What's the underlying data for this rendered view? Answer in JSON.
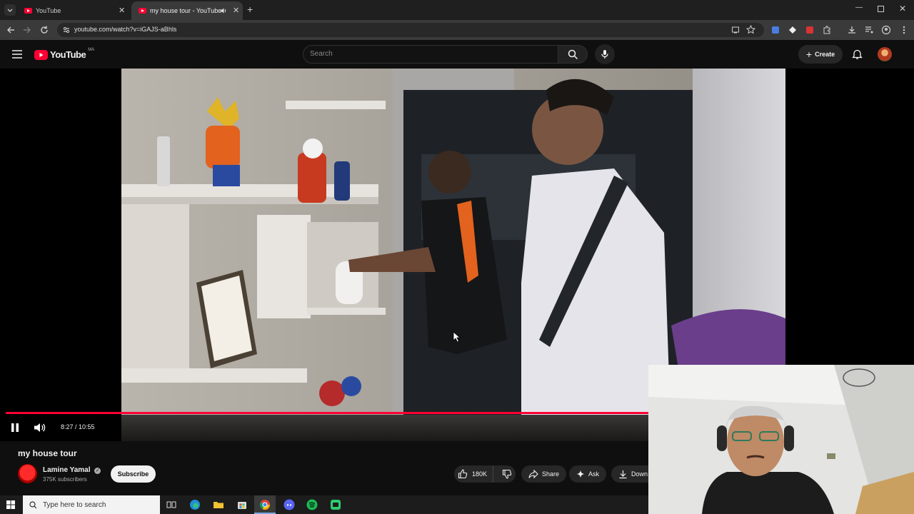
{
  "browser": {
    "tabs": [
      {
        "title": "YouTube",
        "active": false
      },
      {
        "title": "my house tour - YouTube",
        "active": true
      }
    ],
    "url": "youtube.com/watch?v=iGAJS-aBhls"
  },
  "header": {
    "logo_text": "YouTube",
    "region": "MA",
    "search_placeholder": "Search",
    "create_label": "Create"
  },
  "player": {
    "current_time": "8:27",
    "duration": "10:55",
    "time_display": "8:27 / 10:55",
    "progress_fraction": 0.7725,
    "playing": true
  },
  "video": {
    "title": "my house tour",
    "channel": "Lamine Yamal",
    "subscribers": "375K subscribers",
    "subscribe_label": "Subscribe",
    "likes": "180K",
    "share_label": "Share",
    "ask_label": "Ask",
    "download_label": "Down"
  },
  "taskbar": {
    "search_placeholder": "Type here to search"
  },
  "colors": {
    "accent": "#ff0033",
    "background": "#0f0f0f",
    "chip": "#272727"
  },
  "icons": [
    "menu-icon",
    "search-icon",
    "mic-icon",
    "bell-icon",
    "pause-icon",
    "volume-icon",
    "like-icon",
    "dislike-icon",
    "share-icon",
    "ask-sparkle-icon",
    "download-icon",
    "windows-start-icon"
  ]
}
